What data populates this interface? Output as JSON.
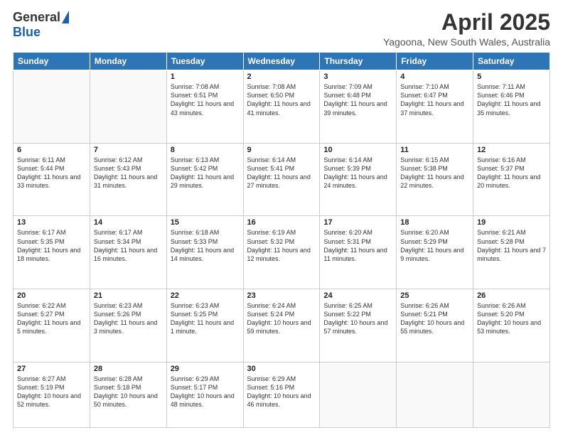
{
  "logo": {
    "general": "General",
    "blue": "Blue"
  },
  "header": {
    "month": "April 2025",
    "location": "Yagoona, New South Wales, Australia"
  },
  "weekdays": [
    "Sunday",
    "Monday",
    "Tuesday",
    "Wednesday",
    "Thursday",
    "Friday",
    "Saturday"
  ],
  "weeks": [
    [
      {
        "day": "",
        "info": ""
      },
      {
        "day": "",
        "info": ""
      },
      {
        "day": "1",
        "info": "Sunrise: 7:08 AM\nSunset: 6:51 PM\nDaylight: 11 hours and 43 minutes."
      },
      {
        "day": "2",
        "info": "Sunrise: 7:08 AM\nSunset: 6:50 PM\nDaylight: 11 hours and 41 minutes."
      },
      {
        "day": "3",
        "info": "Sunrise: 7:09 AM\nSunset: 6:48 PM\nDaylight: 11 hours and 39 minutes."
      },
      {
        "day": "4",
        "info": "Sunrise: 7:10 AM\nSunset: 6:47 PM\nDaylight: 11 hours and 37 minutes."
      },
      {
        "day": "5",
        "info": "Sunrise: 7:11 AM\nSunset: 6:46 PM\nDaylight: 11 hours and 35 minutes."
      }
    ],
    [
      {
        "day": "6",
        "info": "Sunrise: 6:11 AM\nSunset: 5:44 PM\nDaylight: 11 hours and 33 minutes."
      },
      {
        "day": "7",
        "info": "Sunrise: 6:12 AM\nSunset: 5:43 PM\nDaylight: 11 hours and 31 minutes."
      },
      {
        "day": "8",
        "info": "Sunrise: 6:13 AM\nSunset: 5:42 PM\nDaylight: 11 hours and 29 minutes."
      },
      {
        "day": "9",
        "info": "Sunrise: 6:14 AM\nSunset: 5:41 PM\nDaylight: 11 hours and 27 minutes."
      },
      {
        "day": "10",
        "info": "Sunrise: 6:14 AM\nSunset: 5:39 PM\nDaylight: 11 hours and 24 minutes."
      },
      {
        "day": "11",
        "info": "Sunrise: 6:15 AM\nSunset: 5:38 PM\nDaylight: 11 hours and 22 minutes."
      },
      {
        "day": "12",
        "info": "Sunrise: 6:16 AM\nSunset: 5:37 PM\nDaylight: 11 hours and 20 minutes."
      }
    ],
    [
      {
        "day": "13",
        "info": "Sunrise: 6:17 AM\nSunset: 5:35 PM\nDaylight: 11 hours and 18 minutes."
      },
      {
        "day": "14",
        "info": "Sunrise: 6:17 AM\nSunset: 5:34 PM\nDaylight: 11 hours and 16 minutes."
      },
      {
        "day": "15",
        "info": "Sunrise: 6:18 AM\nSunset: 5:33 PM\nDaylight: 11 hours and 14 minutes."
      },
      {
        "day": "16",
        "info": "Sunrise: 6:19 AM\nSunset: 5:32 PM\nDaylight: 11 hours and 12 minutes."
      },
      {
        "day": "17",
        "info": "Sunrise: 6:20 AM\nSunset: 5:31 PM\nDaylight: 11 hours and 11 minutes."
      },
      {
        "day": "18",
        "info": "Sunrise: 6:20 AM\nSunset: 5:29 PM\nDaylight: 11 hours and 9 minutes."
      },
      {
        "day": "19",
        "info": "Sunrise: 6:21 AM\nSunset: 5:28 PM\nDaylight: 11 hours and 7 minutes."
      }
    ],
    [
      {
        "day": "20",
        "info": "Sunrise: 6:22 AM\nSunset: 5:27 PM\nDaylight: 11 hours and 5 minutes."
      },
      {
        "day": "21",
        "info": "Sunrise: 6:23 AM\nSunset: 5:26 PM\nDaylight: 11 hours and 3 minutes."
      },
      {
        "day": "22",
        "info": "Sunrise: 6:23 AM\nSunset: 5:25 PM\nDaylight: 11 hours and 1 minute."
      },
      {
        "day": "23",
        "info": "Sunrise: 6:24 AM\nSunset: 5:24 PM\nDaylight: 10 hours and 59 minutes."
      },
      {
        "day": "24",
        "info": "Sunrise: 6:25 AM\nSunset: 5:22 PM\nDaylight: 10 hours and 57 minutes."
      },
      {
        "day": "25",
        "info": "Sunrise: 6:26 AM\nSunset: 5:21 PM\nDaylight: 10 hours and 55 minutes."
      },
      {
        "day": "26",
        "info": "Sunrise: 6:26 AM\nSunset: 5:20 PM\nDaylight: 10 hours and 53 minutes."
      }
    ],
    [
      {
        "day": "27",
        "info": "Sunrise: 6:27 AM\nSunset: 5:19 PM\nDaylight: 10 hours and 52 minutes."
      },
      {
        "day": "28",
        "info": "Sunrise: 6:28 AM\nSunset: 5:18 PM\nDaylight: 10 hours and 50 minutes."
      },
      {
        "day": "29",
        "info": "Sunrise: 6:29 AM\nSunset: 5:17 PM\nDaylight: 10 hours and 48 minutes."
      },
      {
        "day": "30",
        "info": "Sunrise: 6:29 AM\nSunset: 5:16 PM\nDaylight: 10 hours and 46 minutes."
      },
      {
        "day": "",
        "info": ""
      },
      {
        "day": "",
        "info": ""
      },
      {
        "day": "",
        "info": ""
      }
    ]
  ]
}
